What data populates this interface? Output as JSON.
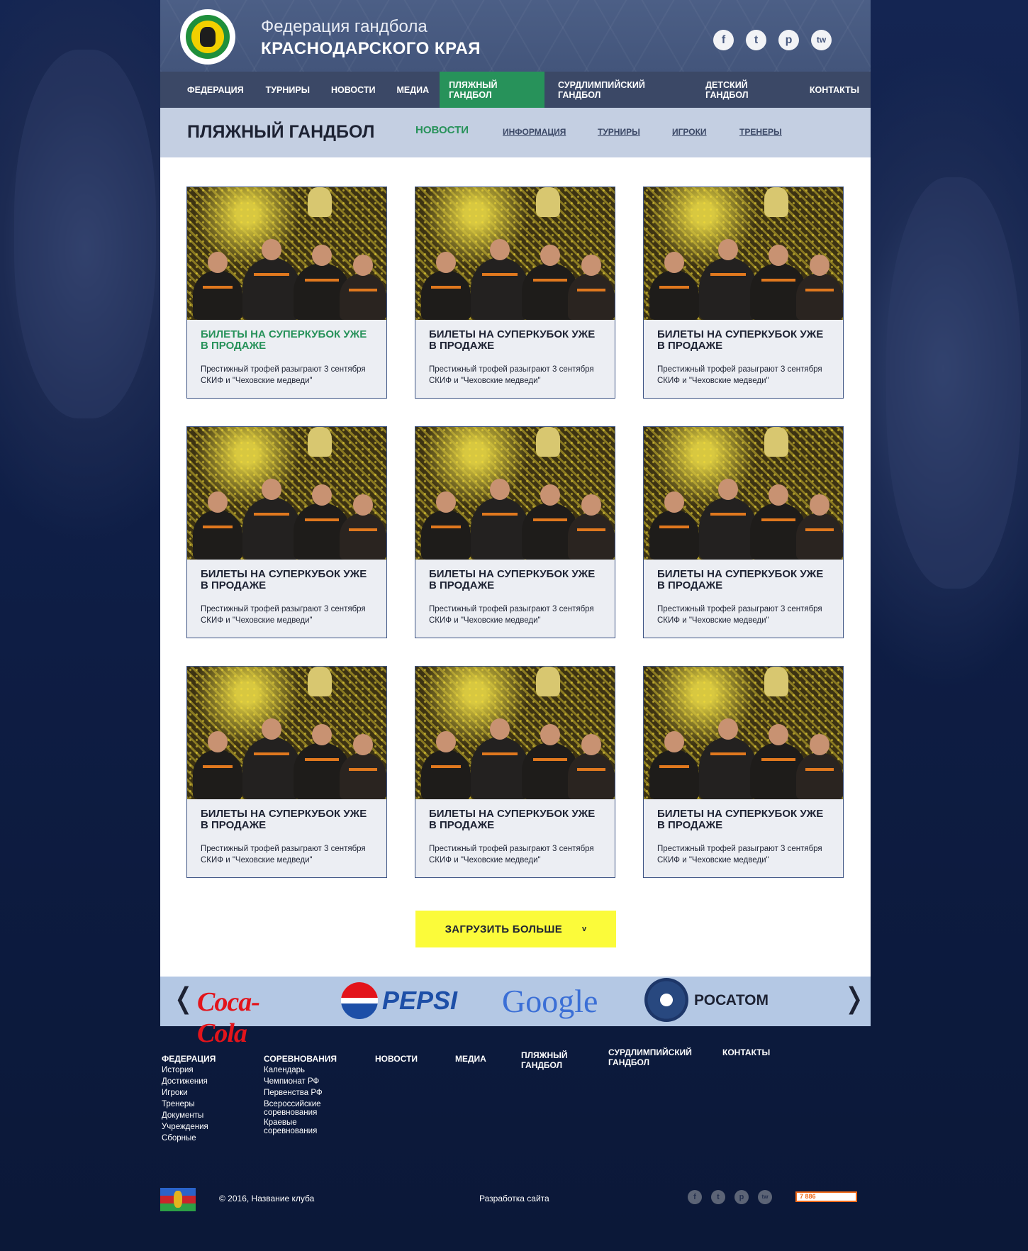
{
  "header": {
    "title_line1": "Федерация гандбола",
    "title_line2": "КРАСНОДАРСКОГО КРАЯ",
    "social": [
      "f",
      "t",
      "p",
      "tw"
    ]
  },
  "nav": [
    {
      "label": "ФЕДЕРАЦИЯ"
    },
    {
      "label": "ТУРНИРЫ"
    },
    {
      "label": "НОВОСТИ"
    },
    {
      "label": "МЕДИА"
    },
    {
      "label": "ПЛЯЖНЫЙ ГАНДБОЛ",
      "active": true
    },
    {
      "label": "СУРДЛИМПИЙСКИЙ ГАНДБОЛ"
    },
    {
      "label": "ДЕТСКИЙ ГАНДБОЛ"
    },
    {
      "label": "КОНТАКТЫ"
    }
  ],
  "subnav": {
    "heading": "ПЛЯЖНЫЙ ГАНДБОЛ",
    "links": [
      "НОВОСТИ",
      "ИНФОРМАЦИЯ",
      "ТУРНИРЫ",
      "ИГРОКИ",
      "ТРЕНЕРЫ"
    ],
    "active": "НОВОСТИ"
  },
  "cards": [
    {
      "title": "БИЛЕТЫ НА СУПЕРКУБОК УЖЕ В ПРОДАЖЕ",
      "desc": "Престижный трофей разыграют 3 сентября СКИФ и \"Чеховские медведи\"",
      "highlight": true
    },
    {
      "title": "БИЛЕТЫ НА СУПЕРКУБОК УЖЕ В ПРОДАЖЕ",
      "desc": "Престижный трофей разыграют 3 сентября СКИФ и \"Чеховские медведи\""
    },
    {
      "title": "БИЛЕТЫ НА СУПЕРКУБОК УЖЕ В ПРОДАЖЕ",
      "desc": "Престижный трофей разыграют 3 сентября СКИФ и \"Чеховские медведи\""
    },
    {
      "title": "БИЛЕТЫ НА СУПЕРКУБОК УЖЕ В ПРОДАЖЕ",
      "desc": "Престижный трофей разыграют 3 сентября СКИФ и \"Чеховские медведи\""
    },
    {
      "title": "БИЛЕТЫ НА СУПЕРКУБОК УЖЕ В ПРОДАЖЕ",
      "desc": "Престижный трофей разыграют 3 сентября СКИФ и \"Чеховские медведи\""
    },
    {
      "title": "БИЛЕТЫ НА СУПЕРКУБОК УЖЕ В ПРОДАЖЕ",
      "desc": "Престижный трофей разыграют 3 сентября СКИФ и \"Чеховские медведи\""
    },
    {
      "title": "БИЛЕТЫ НА СУПЕРКУБОК УЖЕ В ПРОДАЖЕ",
      "desc": "Престижный трофей разыграют 3 сентября СКИФ и \"Чеховские медведи\""
    },
    {
      "title": "БИЛЕТЫ НА СУПЕРКУБОК УЖЕ В ПРОДАЖЕ",
      "desc": "Престижный трофей разыграют 3 сентября СКИФ и \"Чеховские медведи\""
    },
    {
      "title": "БИЛЕТЫ НА СУПЕРКУБОК УЖЕ В ПРОДАЖЕ",
      "desc": "Престижный трофей разыграют 3 сентября СКИФ и \"Чеховские медведи\""
    }
  ],
  "load_more": {
    "label": "ЗАГРУЗИТЬ БОЛЬШЕ",
    "icon": "v"
  },
  "partners": {
    "prev": "❬",
    "next": "❭",
    "logos": [
      "Coca-Cola",
      "PEPSI",
      "Google",
      "РОСАТОМ"
    ]
  },
  "footer": {
    "columns": [
      {
        "heading": "ФЕДЕРАЦИЯ",
        "links": [
          "История",
          "Достижения",
          "Игроки",
          "Тренеры",
          "Документы",
          "Учреждения",
          "Сборные"
        ]
      },
      {
        "heading": "СОРЕВНОВАНИЯ",
        "links": [
          "Календарь",
          "Чемпионат РФ",
          "Первенства РФ",
          "Всероссийские соревнования",
          "Краевые соревнования"
        ]
      },
      {
        "heading": "НОВОСТИ",
        "links": []
      },
      {
        "heading": "МЕДИА",
        "links": []
      },
      {
        "heading": "ПЛЯЖНЫЙ ГАНДБОЛ",
        "links": []
      },
      {
        "heading": "СУРДЛИМПИЙСКИЙ ГАНДБОЛ",
        "links": []
      },
      {
        "heading": "КОНТАКТЫ",
        "links": []
      }
    ],
    "copyright": "© 2016, Название клуба",
    "developer": "Разработка сайта",
    "developer_logo": "7 886",
    "social": [
      "f",
      "t",
      "p",
      "tw"
    ]
  },
  "colors": {
    "accent": "#27925a",
    "nav": "#3b4866",
    "header": "#4a5c82",
    "subnav": "#c4cfe2",
    "button": "#fbfb3a",
    "partners": "#b4c8e4",
    "page_bg": "#0c1a3a"
  }
}
